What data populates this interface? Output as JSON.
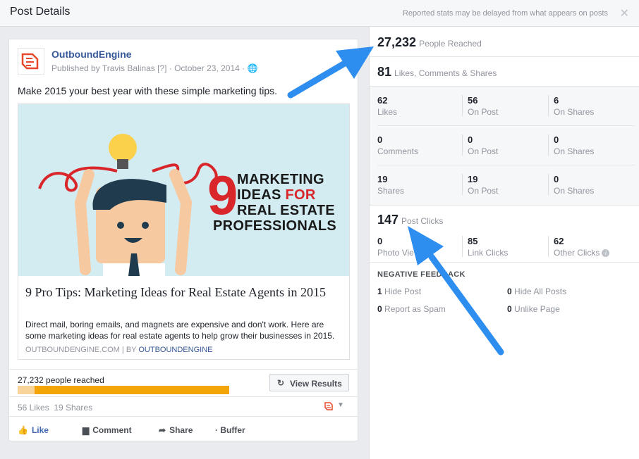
{
  "header": {
    "title": "Post Details",
    "note": "Reported stats may be delayed from what appears on posts",
    "close_glyph": "✕"
  },
  "post": {
    "page_name": "OutboundEngine",
    "meta": "Published by Travis Balinas [?] · October 23, 2014 · 🌐",
    "text": "Make 2015 your best year with these simple marketing tips.",
    "image": {
      "nine": "9",
      "line1": "MARKETING",
      "line2a": "IDEAS ",
      "line2b": "FOR",
      "line3": "REAL ESTATE",
      "line4": "PROFESSIONALS"
    },
    "link_title": "9 Pro Tips: Marketing Ideas for Real Estate Agents in 2015",
    "link_desc": "Direct mail, boring emails, and magnets are expensive and don't work. Here are some marketing ideas for real estate agents to help grow their businesses in 2015.",
    "link_domain": "OUTBOUNDENGINE.COM",
    "link_sep": " | BY ",
    "link_author": "OUTBOUNDENGINE",
    "reach_label": "27,232 people reached",
    "reach_paid_fraction": 0.08,
    "view_results": "View Results",
    "likes": "56 Likes",
    "shares": "19 Shares",
    "actions": {
      "like": "Like",
      "comment": "Comment",
      "share": "Share",
      "buffer": "· Buffer"
    }
  },
  "stats": {
    "reached_num": "27,232",
    "reached_label": "People Reached",
    "engage_num": "81",
    "engage_label": "Likes, Comments & Shares",
    "grid": [
      [
        {
          "n": "62",
          "l": "Likes"
        },
        {
          "n": "56",
          "l": "On Post"
        },
        {
          "n": "6",
          "l": "On Shares"
        }
      ],
      [
        {
          "n": "0",
          "l": "Comments"
        },
        {
          "n": "0",
          "l": "On Post"
        },
        {
          "n": "0",
          "l": "On Shares"
        }
      ],
      [
        {
          "n": "19",
          "l": "Shares"
        },
        {
          "n": "19",
          "l": "On Post"
        },
        {
          "n": "0",
          "l": "On Shares"
        }
      ]
    ],
    "clicks_num": "147",
    "clicks_label": "Post Clicks",
    "clicks": [
      {
        "n": "0",
        "l": "Photo Views"
      },
      {
        "n": "85",
        "l": "Link Clicks"
      },
      {
        "n": "62",
        "l": "Other Clicks"
      }
    ],
    "negative_header": "NEGATIVE FEEDBACK",
    "negative": [
      {
        "n": "1",
        "l": "Hide Post"
      },
      {
        "n": "0",
        "l": "Hide All Posts"
      },
      {
        "n": "0",
        "l": "Report as Spam"
      },
      {
        "n": "0",
        "l": "Unlike Page"
      }
    ]
  },
  "colors": {
    "brand_blue": "#365899",
    "reach_bar": "#f3a407",
    "arrow": "#2d8ef0",
    "accent_red": "#d8262a"
  }
}
